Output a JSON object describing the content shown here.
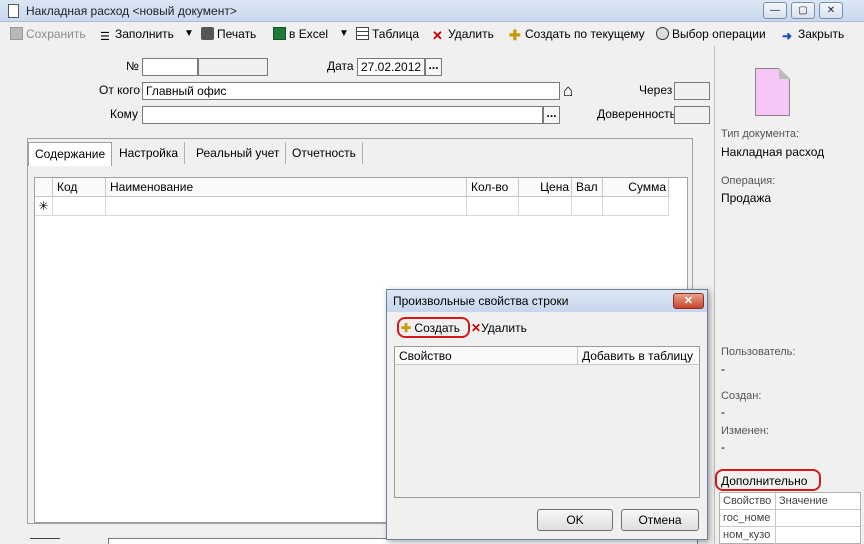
{
  "window": {
    "title": "Накладная расход <новый документ>",
    "controls": [
      "—",
      "▢",
      "✕"
    ]
  },
  "toolbar": {
    "save": "Сохранить",
    "fill": "Заполнить",
    "print": "Печать",
    "excel": "в Excel",
    "table": "Таблица",
    "delete": "Удалить",
    "create_from_current": "Создать по текущему",
    "choose_operation": "Выбор операции",
    "close": "Закрыть"
  },
  "form": {
    "number_label": "№",
    "number_value": "",
    "date_label": "Дата",
    "date_value": "27.02.2012",
    "from_label": "От кого",
    "from_value": "Главный офис",
    "to_label": "Кому",
    "to_value": "",
    "via_label": "Через",
    "via_value": "",
    "power_of_attorney_label": "Доверенность",
    "power_of_attorney_value": "",
    "dots": "..."
  },
  "tabs": [
    "Содержание",
    "Настройка",
    "Реальный учет",
    "Отчетность"
  ],
  "grid": {
    "columns": [
      "Код",
      "Наименование",
      "Кол-во",
      "Цена",
      "Вал",
      "Сумма"
    ],
    "new_row_marker": "✳"
  },
  "right_panel": {
    "doc_type_label": "Тип документа:",
    "doc_type_value": "Накладная расход",
    "operation_label": "Операция:",
    "operation_value": "Продажа",
    "user_label": "Пользователь:",
    "user_value": "-",
    "created_label": "Создан:",
    "created_value": "-",
    "modified_label": "Изменен:",
    "modified_value": "-",
    "additional_label": "Дополнительно",
    "props_columns": [
      "Свойство",
      "Значение"
    ],
    "props_rows": [
      {
        "name": "гос_номе",
        "value": ""
      },
      {
        "name": "ном_кузо",
        "value": ""
      }
    ]
  },
  "dialog": {
    "title": "Произвольные свойства строки",
    "create": "Создать",
    "delete": "Удалить",
    "columns": [
      "Свойство",
      "Добавить в таблицу"
    ],
    "ok": "OK",
    "cancel": "Отмена",
    "close": "✕"
  },
  "colors": {
    "highlight": "#d21a1a",
    "doc_icon": "#f6c6f6"
  }
}
